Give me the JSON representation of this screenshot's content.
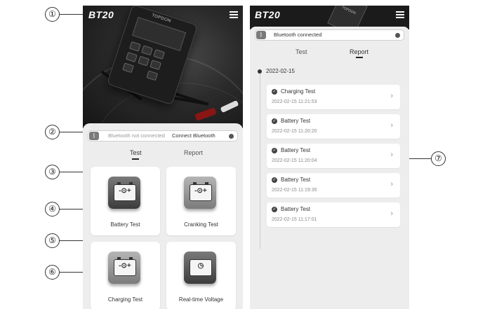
{
  "callouts": [
    "①",
    "②",
    "③",
    "④",
    "⑤",
    "⑥",
    "⑦"
  ],
  "app": {
    "logo": "BT20",
    "menu_icon": "hamburger-menu-icon",
    "device_brand": "TOPDON"
  },
  "test_screen": {
    "status_text": "Bluetooth not connected",
    "status_action": "Connect Bluetooth",
    "tabs": [
      {
        "label": "Test",
        "active": true
      },
      {
        "label": "Report",
        "active": false
      }
    ],
    "tiles": [
      {
        "label": "Battery Test",
        "glyph": "-⊙+"
      },
      {
        "label": "Cranking Test",
        "glyph": "-⊙+"
      },
      {
        "label": "Charging Test",
        "glyph": "-⊙+"
      },
      {
        "label": "Real-time Voltage",
        "glyph": "◷"
      }
    ]
  },
  "report_screen": {
    "status_text": "Bluetooth connected",
    "tabs": [
      {
        "label": "Test",
        "active": false
      },
      {
        "label": "Report",
        "active": true
      }
    ],
    "date": "2022-02-15",
    "records": [
      {
        "title": "Charging Test",
        "datetime": "2022-02-15 11:21:53"
      },
      {
        "title": "Battery Test",
        "datetime": "2022-02-15 11:20:20"
      },
      {
        "title": "Battery Test",
        "datetime": "2022-02-15 11:20:04"
      },
      {
        "title": "Battery Test",
        "datetime": "2022-02-15 11:19:35"
      },
      {
        "title": "Battery Test",
        "datetime": "2022-02-15 11:17:01"
      }
    ]
  }
}
